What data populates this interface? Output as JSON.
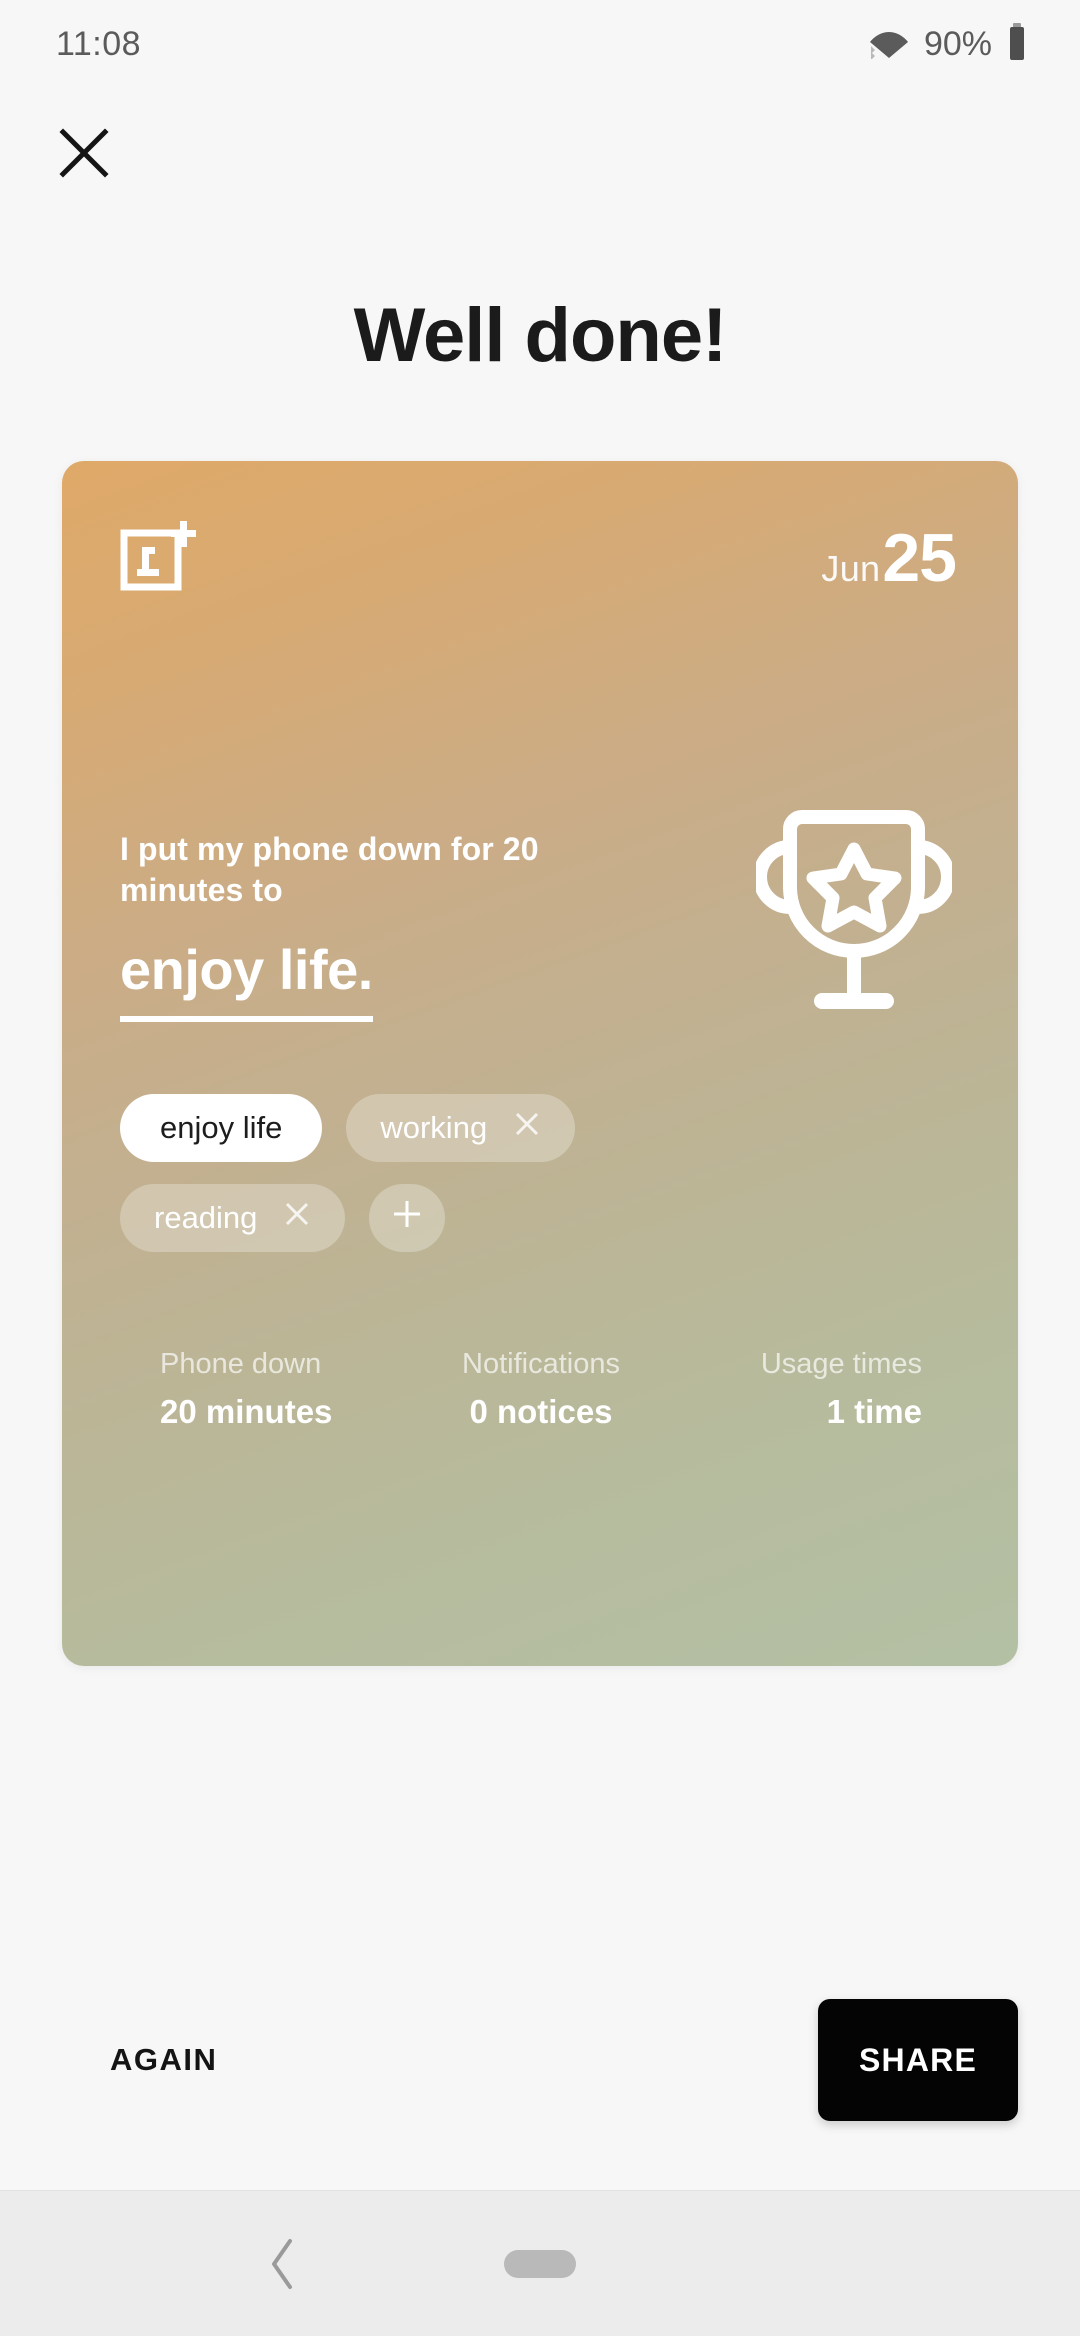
{
  "status_bar": {
    "time": "11:08",
    "battery_percent": "90%",
    "wifi_icon": "wifi-icon",
    "battery_icon": "battery-icon"
  },
  "header": {
    "close_icon": "close-icon",
    "title": "Well done!"
  },
  "card": {
    "brand_logo": "oneplus-logo",
    "date": {
      "month": "Jun",
      "day": "25"
    },
    "sentence": {
      "lead": "I put my phone down for 20 minutes to",
      "highlight": "enjoy life."
    },
    "trophy_icon": "trophy-icon",
    "tags": [
      {
        "label": "enjoy life",
        "selected": true,
        "removable": false
      },
      {
        "label": "working",
        "selected": false,
        "removable": true
      },
      {
        "label": "reading",
        "selected": false,
        "removable": true
      }
    ],
    "add_tag_label": "+",
    "stats": [
      {
        "label": "Phone down",
        "value": "20 minutes"
      },
      {
        "label": "Notifications",
        "value": "0 notices"
      },
      {
        "label": "Usage times",
        "value": "1 time"
      }
    ],
    "gradient_from": "#dfa968",
    "gradient_to": "#b3c0a4"
  },
  "footer": {
    "again_label": "AGAIN",
    "share_label": "SHARE",
    "share_bg": "#040404"
  },
  "nav_bar": {
    "back_icon": "chevron-left-icon",
    "home_icon": "home-pill-icon"
  }
}
